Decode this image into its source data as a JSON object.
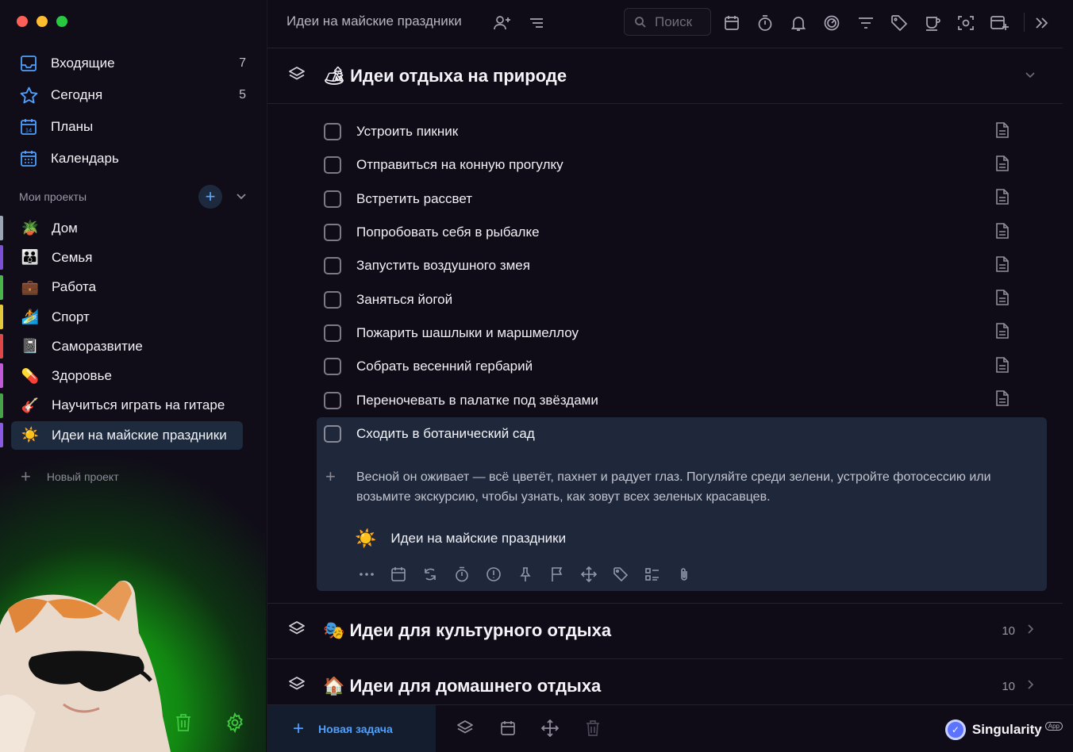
{
  "window": {
    "title": "Идеи на майские праздники"
  },
  "sidebar": {
    "nav": [
      {
        "label": "Входящие",
        "count": "7",
        "icon": "inbox-icon"
      },
      {
        "label": "Сегодня",
        "count": "5",
        "icon": "star-icon"
      },
      {
        "label": "Планы",
        "count": "",
        "icon": "calendar-14-icon"
      },
      {
        "label": "Календарь",
        "count": "",
        "icon": "calendar-grid-icon"
      }
    ],
    "projects_header": "Мои проекты",
    "projects": [
      {
        "emoji": "🪴",
        "label": "Дом",
        "color": "#9aa5b1"
      },
      {
        "emoji": "👪",
        "label": "Семья",
        "color": "#7b4fd6"
      },
      {
        "emoji": "💼",
        "label": "Работа",
        "color": "#48b64a"
      },
      {
        "emoji": "🏄",
        "label": "Спорт",
        "color": "#e3c93a"
      },
      {
        "emoji": "📓",
        "label": "Саморазвитие",
        "color": "#e04848"
      },
      {
        "emoji": "💊",
        "label": "Здоровье",
        "color": "#c15ad6"
      },
      {
        "emoji": "🎸",
        "label": "Научиться играть на гитаре",
        "color": "#47a34a"
      },
      {
        "emoji": "☀️",
        "label": "Идеи на майские праздники",
        "color": "#8a5ae6"
      }
    ],
    "new_project": "Новый проект"
  },
  "search": {
    "placeholder": "Поиск"
  },
  "sections": [
    {
      "emoji": "🏕",
      "title": "Идеи отдыха на природе",
      "count": ""
    },
    {
      "emoji": "🎭",
      "title": "Идеи для культурного отдыха",
      "count": "10"
    },
    {
      "emoji": "🏠",
      "title": "Идеи для домашнего отдыха",
      "count": "10"
    }
  ],
  "tasks": [
    "Устроить пикник",
    "Отправиться на конную прогулку",
    "Встретить рассвет",
    "Попробовать себя в рыбалке",
    "Запустить воздушного змея",
    "Заняться йогой",
    "Пожарить шашлыки и маршмеллоу",
    "Собрать весенний гербарий",
    "Переночевать в палатке под звёздами"
  ],
  "expanded_task": {
    "title": "Сходить в ботанический сад",
    "description": "Весной он оживает — всё цветёт, пахнет и радует глаз. Погуляйте среди зелени, устройте фотосессию или возьмите экскурсию, чтобы узнать, как зовут всех зеленых красавцев.",
    "project_emoji": "☀️",
    "project": "Идеи на майские праздники"
  },
  "bottom": {
    "new_task": "Новая задача",
    "brand": "Singularity",
    "brand_tag": "App"
  }
}
